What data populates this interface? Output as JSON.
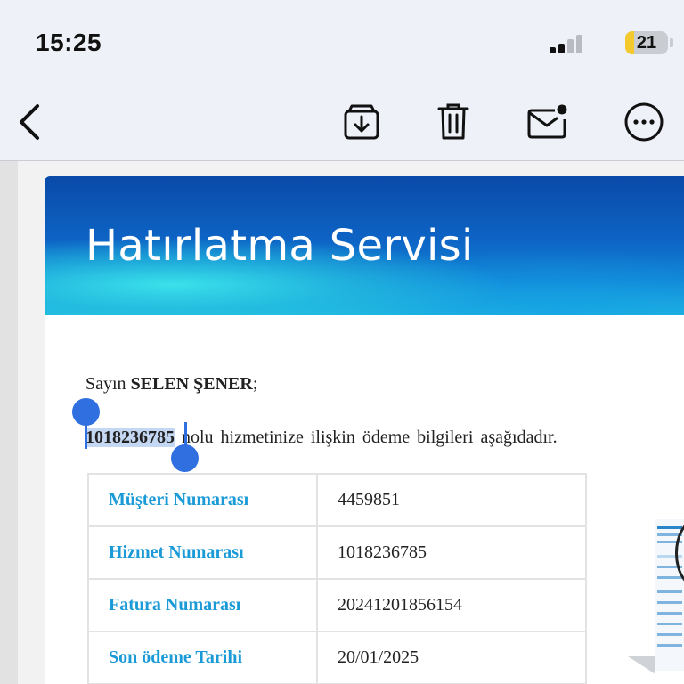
{
  "status_bar": {
    "time": "15:25",
    "battery": 21,
    "battery_label": "21",
    "colors": {
      "battery_fill": "#f4c92d",
      "signal_active": "#111111",
      "signal_inactive": "#b8bbbf"
    }
  },
  "toolbar": {
    "icons": [
      "back-chevron-icon",
      "archive-icon",
      "trash-icon",
      "mark-unread-icon",
      "more-icon"
    ]
  },
  "email": {
    "banner_title": "Hatırlatma Servisi",
    "greeting_prefix": "Sayın",
    "customer_name": "SELEN ŞENER",
    "greeting_suffix": ";",
    "selected_service_number": "1018236785",
    "service_line_rest": " nolu hizmetinize ilişkin ödeme bilgileri aşağıdadır.",
    "table": [
      {
        "label": "Müşteri Numarası",
        "value": "4459851"
      },
      {
        "label": "Hizmet Numarası",
        "value": "1018236785"
      },
      {
        "label": "Fatura Numarası",
        "value": "20241201856154"
      },
      {
        "label": "Son ödeme Tarihi",
        "value": "20/01/2025"
      }
    ],
    "colors": {
      "label_blue": "#1a9ad6",
      "selection": "#c4d8f3",
      "handle_blue": "#2f6fe0"
    }
  }
}
